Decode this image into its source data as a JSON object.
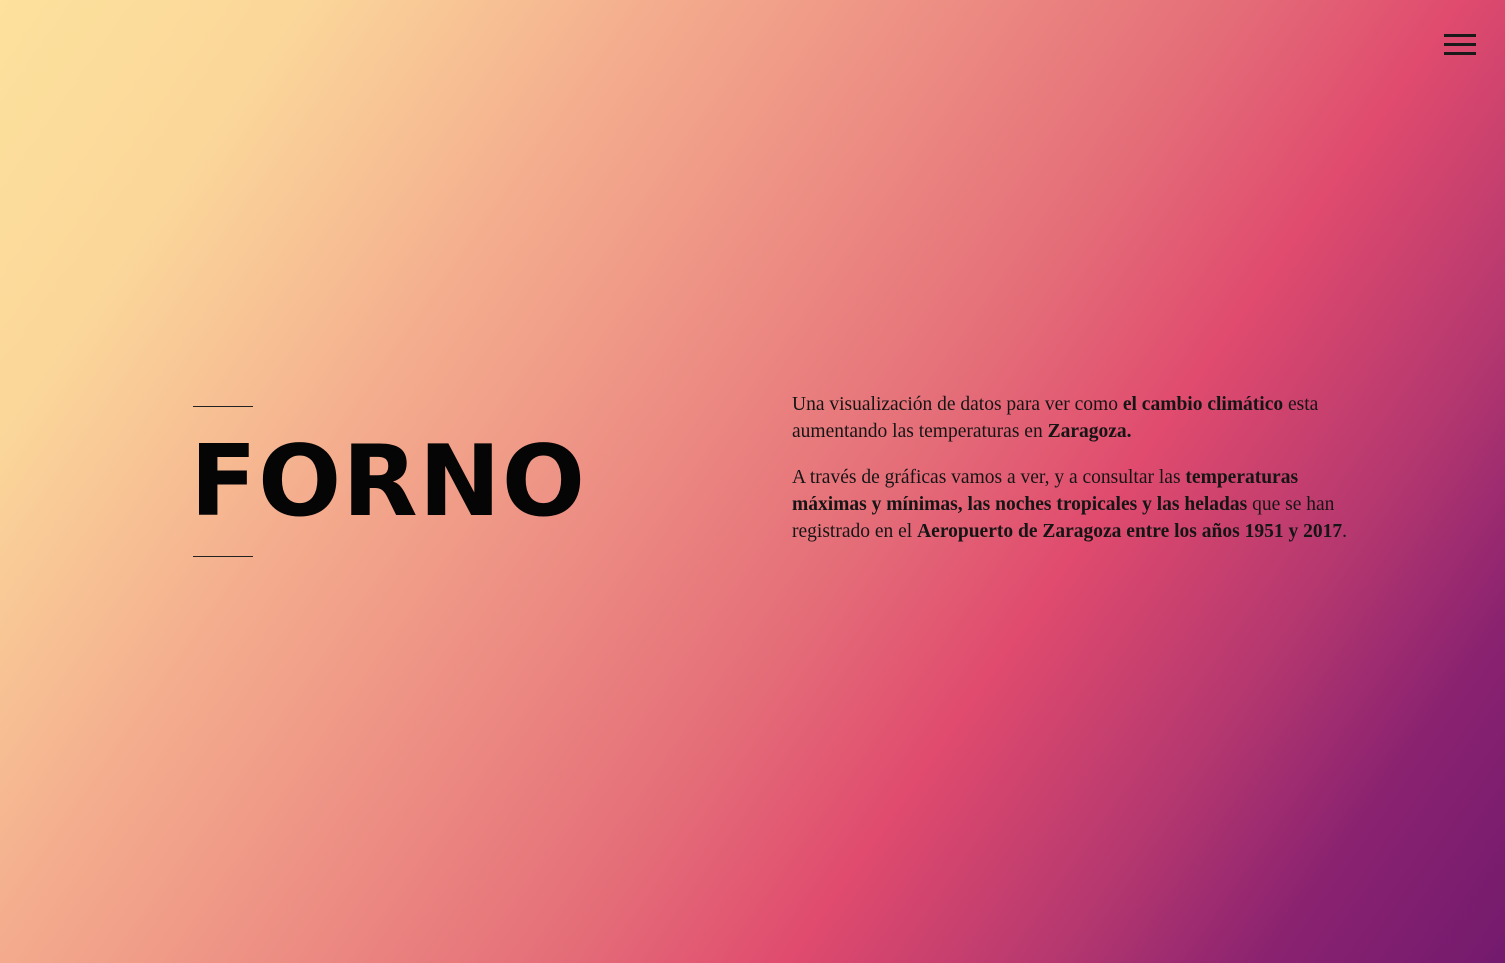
{
  "menu": {
    "icon": "hamburger-menu-icon"
  },
  "hero": {
    "title": "FORNO"
  },
  "intro": {
    "p1": {
      "t1": "Una visualización de datos para ver como ",
      "b1": "el cambio climático",
      "t2": " esta aumentando las temperaturas en ",
      "b2": "Zaragoza."
    },
    "p2": {
      "t1": "A través de gráficas vamos a ver, y a consultar las ",
      "b1": "temperaturas máximas y mínimas, las noches tropicales y las heladas",
      "t2": " que se han registrado en el ",
      "b2": "Aeropuerto de Zaragoza entre los años 1951 y 2017",
      "t3": "."
    }
  },
  "colors": {
    "gradient": [
      "#fde19c",
      "#f4ad8e",
      "#e04b6e",
      "#731a6e"
    ],
    "text": "#111111"
  }
}
